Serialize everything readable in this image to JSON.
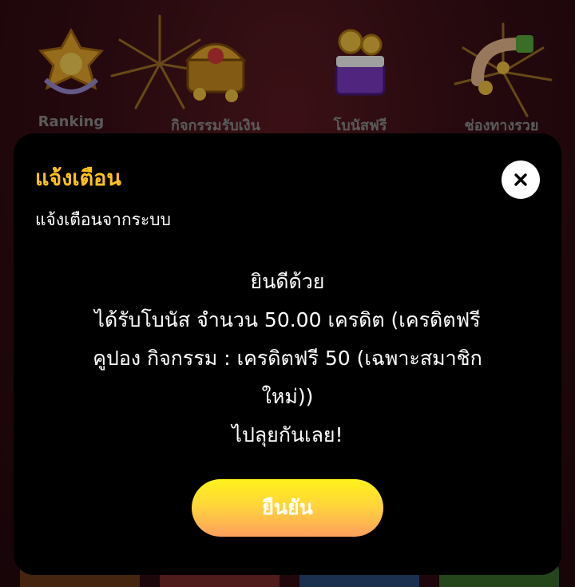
{
  "background": {
    "menu_items": [
      {
        "label": "Ranking",
        "icon": "trophy-star-icon"
      },
      {
        "label": "กิจกรรมรับเงิน",
        "icon": "treasure-chest-icon"
      },
      {
        "label": "โบนัสฟรี",
        "icon": "gift-coins-icon"
      },
      {
        "label": "ช่องทางรวย",
        "icon": "pipe-coins-icon"
      }
    ]
  },
  "modal": {
    "title": "แจ้งเตือน",
    "subtitle": "แจ้งเตือนจากระบบ",
    "close_icon": "close-icon",
    "message_lines": [
      "ยินดีด้วย",
      "ได้รับโบนัส จำนวน 50.00 เครดิต (เครดิตฟรี",
      "คูปอง กิจกรรม : เครดิตฟรี 50 (เฉพาะสมาชิก",
      "ใหม่))",
      "ไปลุยกันเลย!"
    ],
    "confirm_label": "ยืนยัน"
  },
  "colors": {
    "title": "#ffc21a",
    "modal_bg": "#000000",
    "button_top": "#fff21a",
    "button_bottom": "#ff9f5e"
  }
}
